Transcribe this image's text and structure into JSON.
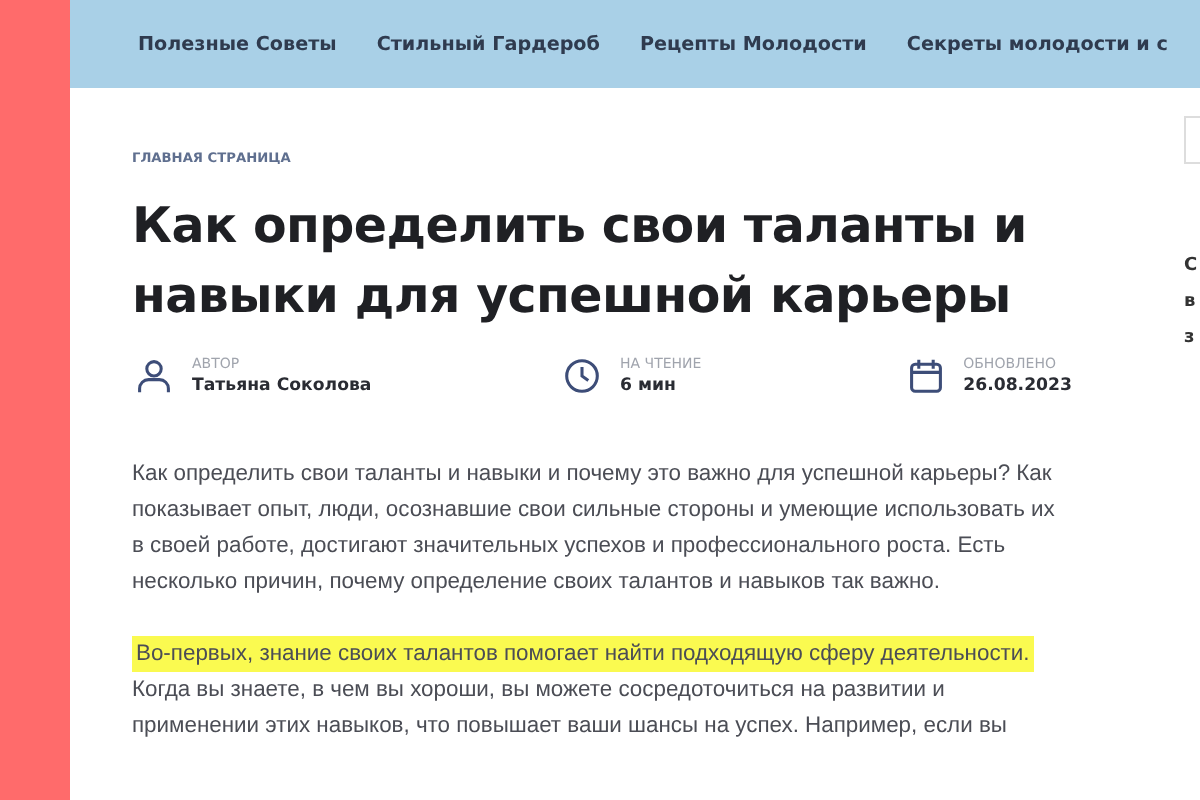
{
  "nav": {
    "items": [
      {
        "label": "Полезные Советы"
      },
      {
        "label": "Стильный Гардероб"
      },
      {
        "label": "Рецепты Молодости"
      },
      {
        "label": "Секреты молодости и с"
      }
    ]
  },
  "breadcrumb": "ГЛАВНАЯ СТРАНИЦА",
  "title": "Как определить свои таланты и навыки для успешной карьеры",
  "meta": [
    {
      "kind": "author",
      "label": "АВТОР",
      "value": "Татьяна Соколова"
    },
    {
      "kind": "reading",
      "label": "НА ЧТЕНИЕ",
      "value": "6 мин"
    },
    {
      "kind": "updated",
      "label": "ОБНОВЛЕНО",
      "value": "26.08.2023"
    }
  ],
  "paragraphs": [
    {
      "text": "Как определить свои таланты и навыки и почему это важно для успешной карьеры? Как показывает опыт, люди, осознавшие свои сильные стороны и умеющие использовать их в своей работе, достигают значительных успехов и профессионального роста. Есть несколько причин, почему определение своих талантов и навыков так важно."
    },
    {
      "highlight": "Во-первых, знание своих талантов помогает найти подходящую сферу деятельности.",
      "text": "Когда вы знаете, в чем вы хороши, вы можете сосредоточиться на развитии и применении этих навыков, что повышает ваши шансы на успех. Например, если вы"
    }
  ],
  "sidebar_fragments": [
    "С",
    "в",
    "з"
  ]
}
